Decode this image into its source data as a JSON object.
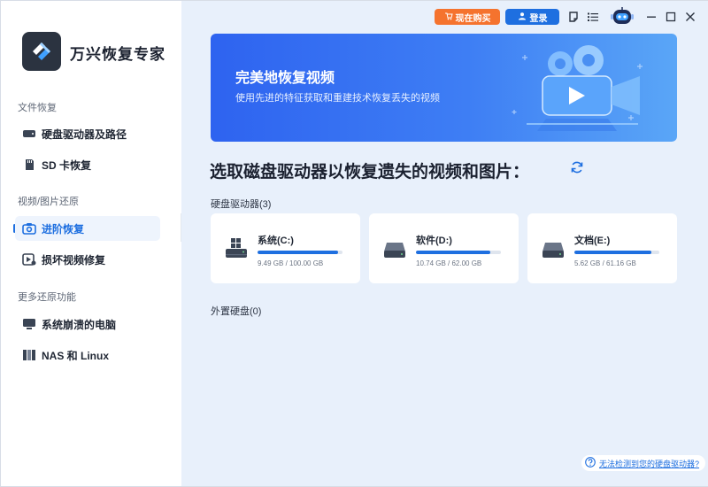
{
  "app": {
    "name": "万兴恢复专家"
  },
  "topbar": {
    "buy_label": "现在购买",
    "login_label": "登录"
  },
  "sidebar": {
    "sections": [
      {
        "label": "文件恢复"
      },
      {
        "label": "视频/图片还原"
      },
      {
        "label": "更多还原功能"
      }
    ],
    "items": [
      {
        "label": "硬盘驱动器及路径",
        "icon": "hard-disk-icon"
      },
      {
        "label": "SD 卡恢复",
        "icon": "sd-card-icon"
      },
      {
        "label": "进阶恢复",
        "icon": "camera-icon",
        "active": true
      },
      {
        "label": "损坏视频修复",
        "icon": "video-repair-icon"
      },
      {
        "label": "系统崩溃的电脑",
        "icon": "monitor-icon"
      },
      {
        "label": "NAS 和 Linux",
        "icon": "nas-icon"
      }
    ]
  },
  "banner": {
    "title": "完美地恢复视频",
    "subtitle": "使用先进的特征获取和重建技术恢复丢失的视频"
  },
  "main": {
    "heading": "选取磁盘驱动器以恢复遗失的视频和图片：",
    "internal_label": "硬盘驱动器(3)",
    "external_label": "外置硬盘(0)"
  },
  "drives": [
    {
      "name": "系统(C:)",
      "size": "9.49 GB / 100.00 GB",
      "used_fraction": 0.95
    },
    {
      "name": "软件(D:)",
      "size": "10.74 GB / 62.00 GB",
      "used_fraction": 0.87
    },
    {
      "name": "文档(E:)",
      "size": "5.62 GB / 61.16 GB",
      "used_fraction": 0.91
    }
  ],
  "help": {
    "label": "无法检测到您的硬盘驱动器?"
  },
  "colors": {
    "accent": "#1e6fe0",
    "buy": "#f5732e",
    "main_bg": "#e8f0fb"
  }
}
